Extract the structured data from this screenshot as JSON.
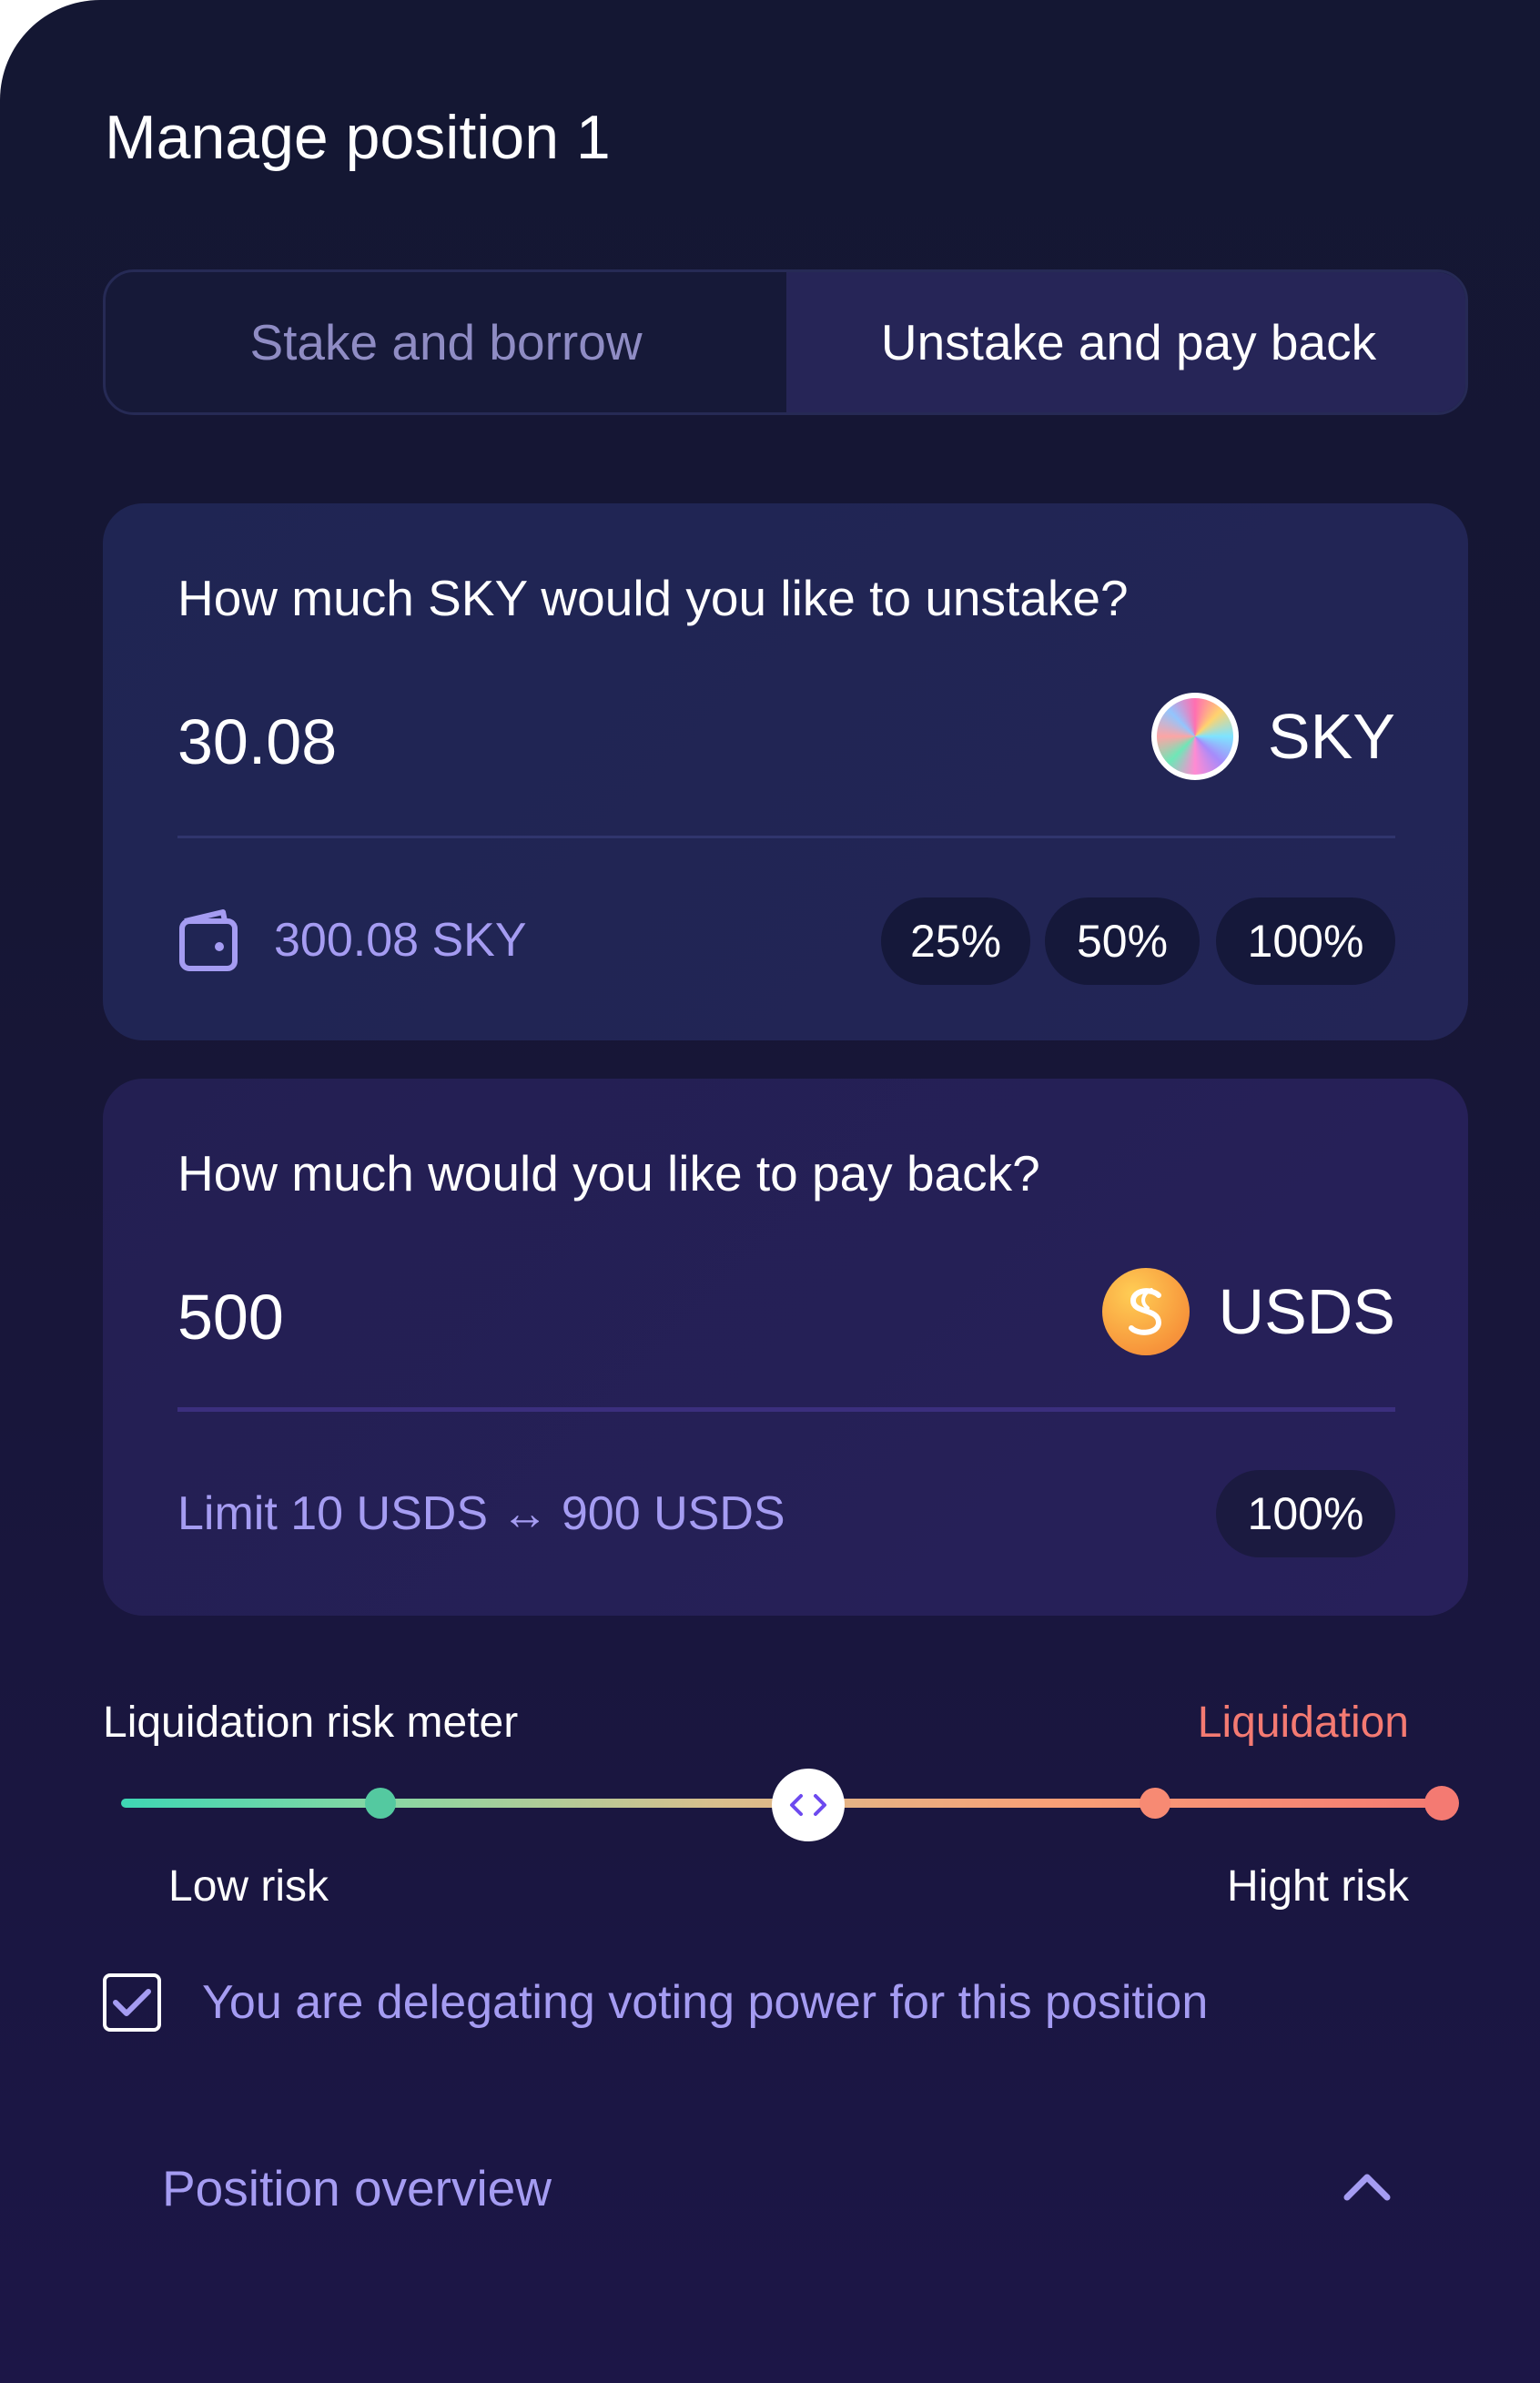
{
  "title": "Manage position 1",
  "tabs": [
    {
      "label": "Stake and borrow",
      "active": false
    },
    {
      "label": "Unstake and pay back",
      "active": true
    }
  ],
  "unstake": {
    "question": "How much SKY would you like to unstake?",
    "amount": "30.08",
    "token": "SKY",
    "balance": "300.08 SKY",
    "presets": [
      "25%",
      "50%",
      "100%"
    ]
  },
  "payback": {
    "question": "How much would you like to pay back?",
    "amount": "500",
    "token": "USDS",
    "limit": "Limit 10 USDS ↔ 900 USDS",
    "presets": [
      "100%"
    ]
  },
  "risk_meter": {
    "label": "Liquidation risk meter",
    "liquidation_label": "Liquidation",
    "low_label": "Low risk",
    "high_label": "Hight risk",
    "level": 0.52,
    "colors": {
      "low": "#3ed6b4",
      "high": "#f47a72"
    }
  },
  "delegation": {
    "checked": true,
    "label": "You are delegating voting power for this position"
  },
  "overview": {
    "label": "Position overview",
    "expanded": true
  },
  "icons": {
    "sky": "sky-token-icon",
    "usds": "usds-token-icon",
    "wallet": "wallet-icon",
    "handle": "code-arrows-icon",
    "check": "check-icon",
    "chevron": "chevron-up-icon"
  }
}
